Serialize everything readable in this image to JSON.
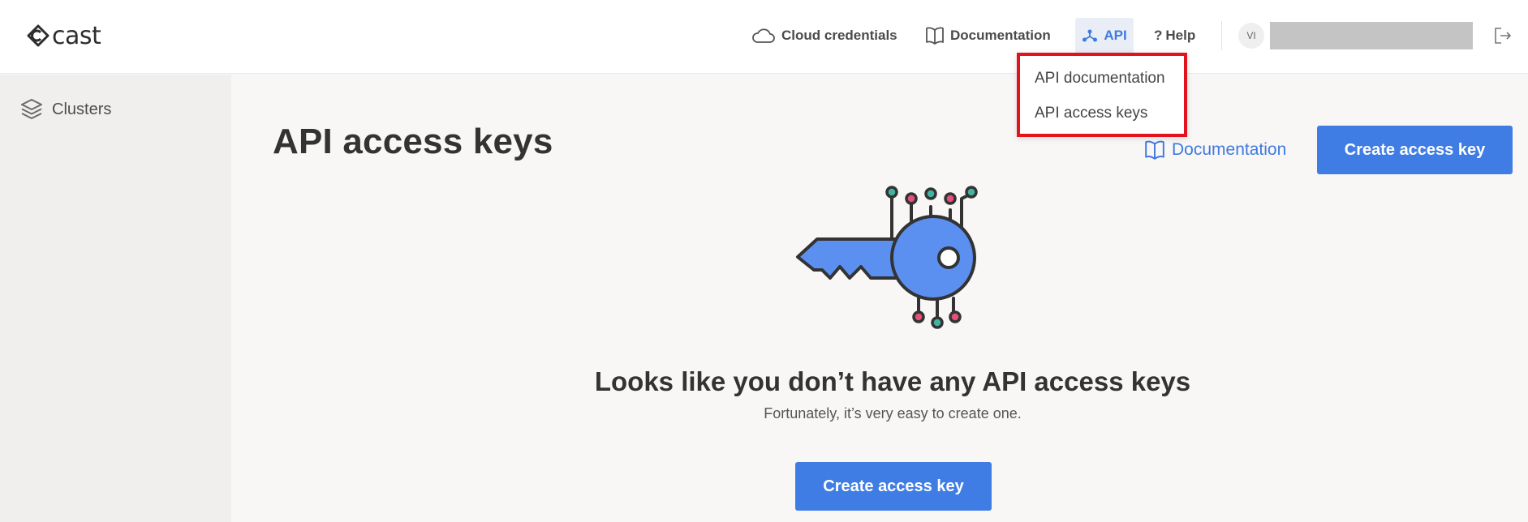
{
  "app": {
    "logo_text": "cast"
  },
  "topnav": {
    "cloud_credentials": "Cloud credentials",
    "documentation": "Documentation",
    "api": "API",
    "help": "Help",
    "avatar_initials": "VI"
  },
  "api_menu": {
    "items": [
      "API documentation",
      "API access keys"
    ]
  },
  "sidebar": {
    "items": [
      {
        "label": "Clusters",
        "icon": "layers-icon"
      }
    ]
  },
  "main": {
    "title": "API access keys",
    "documentation_link": "Documentation",
    "create_button": "Create access key",
    "empty_title": "Looks like you don’t have any API access keys",
    "empty_subtitle": "Fortunately, it’s very easy to create one.",
    "empty_button": "Create access key"
  },
  "colors": {
    "accent": "#3f7de4",
    "highlight_border": "#e1141e",
    "key_blue": "#5b8ff0"
  }
}
